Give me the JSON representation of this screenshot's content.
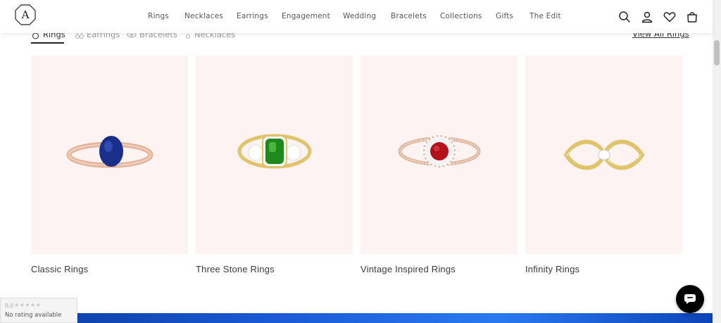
{
  "header": {
    "logo_letter": "A",
    "nav": [
      "Rings",
      "Necklaces",
      "Earrings",
      "Engagement",
      "Wedding",
      "Bracelets",
      "Collections",
      "Gifts",
      "The Edit"
    ],
    "icons": [
      "search-icon",
      "user-icon",
      "heart-icon",
      "bag-icon"
    ]
  },
  "category_tabs": {
    "items": [
      {
        "label": "Rings",
        "icon": "ring-icon",
        "active": true
      },
      {
        "label": "Earrings",
        "icon": "earring-icon",
        "active": false
      },
      {
        "label": "Bracelets",
        "icon": "bracelet-icon",
        "active": false
      },
      {
        "label": "Necklaces",
        "icon": "necklace-icon",
        "active": false
      }
    ],
    "view_all": "View All Rings"
  },
  "products": [
    {
      "title": "Classic Rings",
      "stone_color": "#1a2f8a",
      "metal_color": "#e3b39a"
    },
    {
      "title": "Three Stone Rings",
      "stone_color": "#1f8a1c",
      "metal_color": "#e0c36a"
    },
    {
      "title": "Vintage Inspired Rings",
      "stone_color": "#b3121c",
      "metal_color": "#e3b39a"
    },
    {
      "title": "Infinity Rings",
      "stone_color": "#ffffff",
      "metal_color": "#e0c36a"
    }
  ],
  "rating_widget": {
    "score": "0.0",
    "stars": "★★★★★",
    "text": "No rating available"
  },
  "colors": {
    "card_bg": "#fdf3f2",
    "banner_blue": "#1a5bd8",
    "chat_button": "#000000"
  }
}
